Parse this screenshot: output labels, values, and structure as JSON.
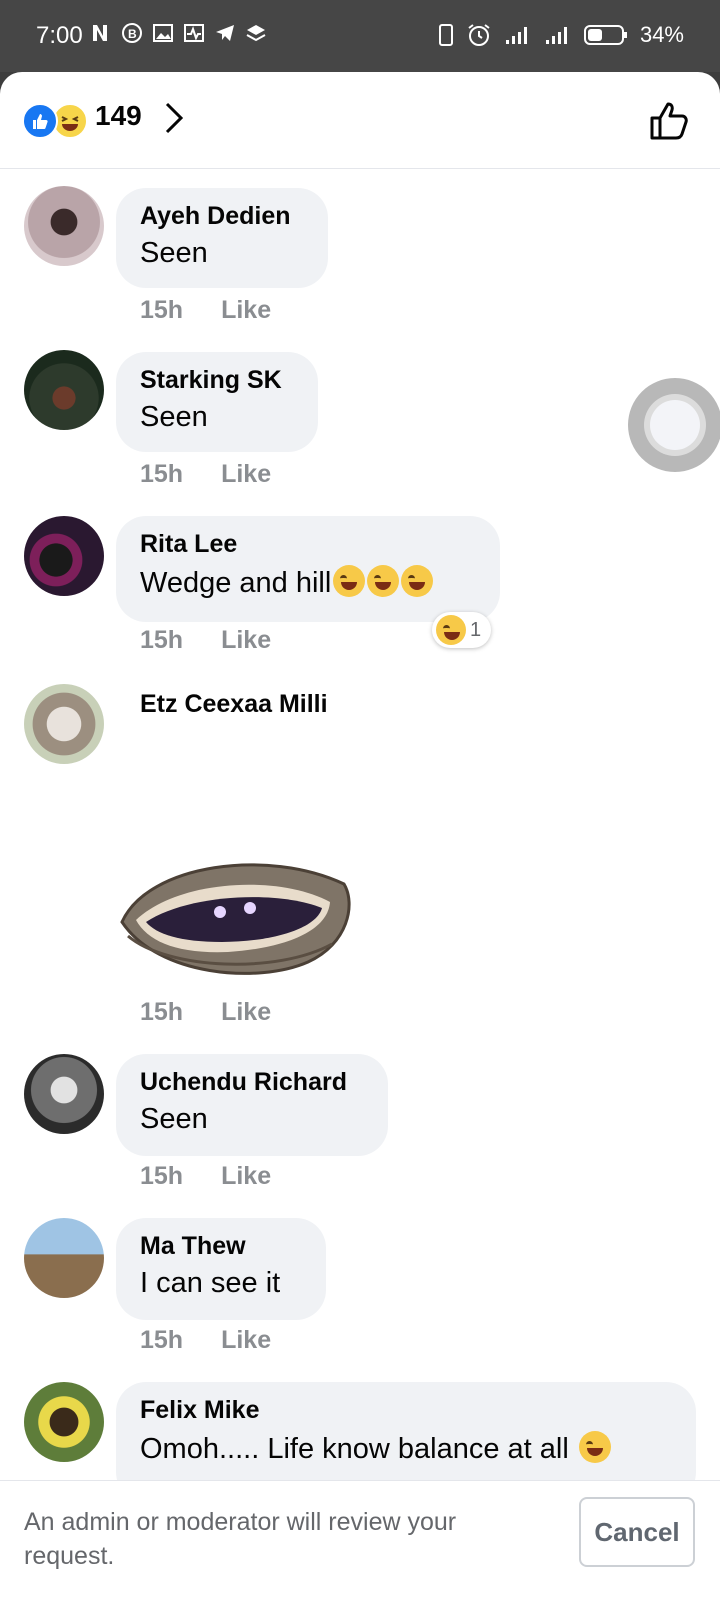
{
  "status_bar": {
    "time": "7:00",
    "battery": "34%",
    "left_icons": [
      "netflix-icon",
      "b-circle-icon",
      "image-icon",
      "activity-icon",
      "telegram-icon",
      "layers-icon"
    ],
    "right_icons": [
      "vibrate-icon",
      "alarm-icon",
      "signal-icon",
      "signal-icon",
      "battery-icon"
    ]
  },
  "header": {
    "reactions": [
      "like",
      "haha"
    ],
    "reaction_count": "149"
  },
  "comments": [
    {
      "name": "Ayeh Dedien",
      "text": "Seen",
      "time": "15h",
      "like": "Like"
    },
    {
      "name": "Starking SK",
      "text": "Seen",
      "time": "15h",
      "like": "Like"
    },
    {
      "name": "Rita Lee",
      "text": "Wedge and hill",
      "time": "15h",
      "like": "Like",
      "reaction_badge_count": "1"
    },
    {
      "name": "Etz Ceexaa Milli",
      "text": "",
      "time": "15h",
      "like": "Like",
      "sticker": "oyster-sticker"
    },
    {
      "name": "Uchendu Richard",
      "text": "Seen",
      "time": "15h",
      "like": "Like"
    },
    {
      "name": "Ma Thew",
      "text": "I can see it",
      "time": "15h",
      "like": "Like"
    },
    {
      "name": "Felix Mike",
      "text": "Omoh..... Life know balance at all"
    }
  ],
  "footer": {
    "message": "An admin or moderator will review your request.",
    "cancel_label": "Cancel"
  },
  "colors": {
    "like_blue": "#1877f2",
    "bubble_bg": "#f0f2f5",
    "meta_gray": "#8a8d91"
  }
}
